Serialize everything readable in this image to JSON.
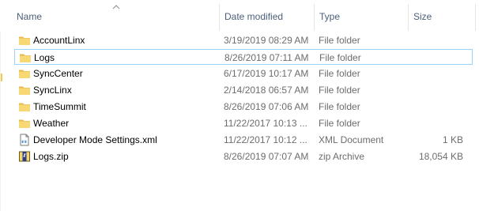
{
  "columns": {
    "name": "Name",
    "date": "Date modified",
    "type": "Type",
    "size": "Size"
  },
  "files": [
    {
      "name": "AccountLinx",
      "date": "3/19/2019 08:29 AM",
      "type": "File folder",
      "size": "",
      "icon": "folder-icon",
      "selected": false
    },
    {
      "name": "Logs",
      "date": "8/26/2019 07:11 AM",
      "type": "File folder",
      "size": "",
      "icon": "folder-icon",
      "selected": true
    },
    {
      "name": "SyncCenter",
      "date": "6/17/2019 10:17 AM",
      "type": "File folder",
      "size": "",
      "icon": "folder-icon",
      "selected": false
    },
    {
      "name": "SyncLinx",
      "date": "2/14/2018 06:57 AM",
      "type": "File folder",
      "size": "",
      "icon": "folder-icon",
      "selected": false
    },
    {
      "name": "TimeSummit",
      "date": "8/26/2019 07:06 AM",
      "type": "File folder",
      "size": "",
      "icon": "folder-icon",
      "selected": false
    },
    {
      "name": "Weather",
      "date": "11/22/2017 10:13 ...",
      "type": "File folder",
      "size": "",
      "icon": "folder-icon",
      "selected": false
    },
    {
      "name": "Developer Mode Settings.xml",
      "date": "11/22/2017 10:12 ...",
      "type": "XML Document",
      "size": "1 KB",
      "icon": "xml-file-icon",
      "selected": false
    },
    {
      "name": "Logs.zip",
      "date": "8/26/2019 07:07 AM",
      "type": "zip Archive",
      "size": "18,054 KB",
      "icon": "zip-archive-icon",
      "selected": false
    }
  ],
  "colors": {
    "header_text": "#4c607a",
    "selection_border": "#99d1ff",
    "folder": "#f2c94c"
  }
}
